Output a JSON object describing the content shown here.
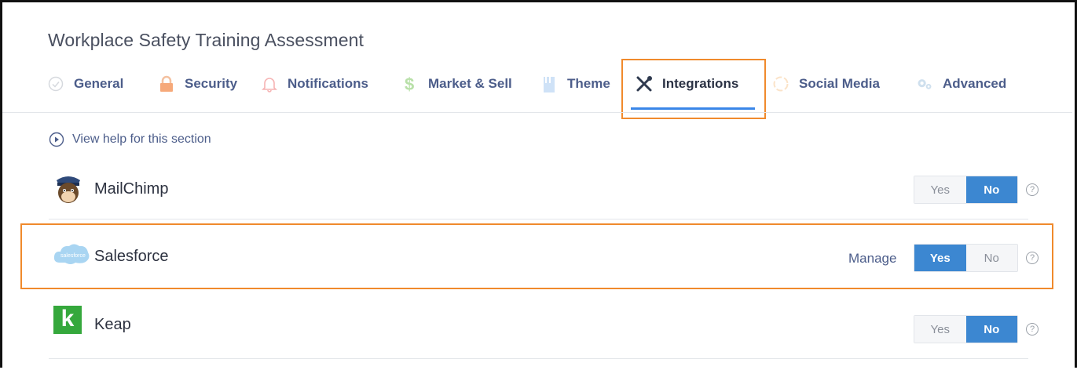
{
  "page_title": "Workplace Safety Training Assessment",
  "tabs": [
    {
      "label": "General",
      "icon": "check-circle-icon"
    },
    {
      "label": "Security",
      "icon": "lock-icon"
    },
    {
      "label": "Notifications",
      "icon": "bell-icon"
    },
    {
      "label": "Market & Sell",
      "icon": "dollar-icon"
    },
    {
      "label": "Theme",
      "icon": "brush-icon"
    },
    {
      "label": "Integrations",
      "icon": "tools-icon",
      "active": true
    },
    {
      "label": "Social Media",
      "icon": "share-icon"
    },
    {
      "label": "Advanced",
      "icon": "gears-icon"
    }
  ],
  "help_link": "View help for this section",
  "integrations": [
    {
      "name": "MailChimp",
      "logo": "mailchimp-logo",
      "yes": "Yes",
      "no": "No",
      "state": "No",
      "help": "?"
    },
    {
      "name": "Salesforce",
      "logo": "salesforce-logo",
      "manage": "Manage",
      "yes": "Yes",
      "no": "No",
      "state": "Yes",
      "help": "?"
    },
    {
      "name": "Keap",
      "logo": "keap-logo",
      "logo_letter": "k",
      "yes": "Yes",
      "no": "No",
      "state": "No",
      "help": "?"
    }
  ],
  "colors": {
    "accent": "#3c87d1",
    "highlight": "#f08a2c",
    "tab_text": "#4c5d8a",
    "keap_green": "#35a83c"
  }
}
